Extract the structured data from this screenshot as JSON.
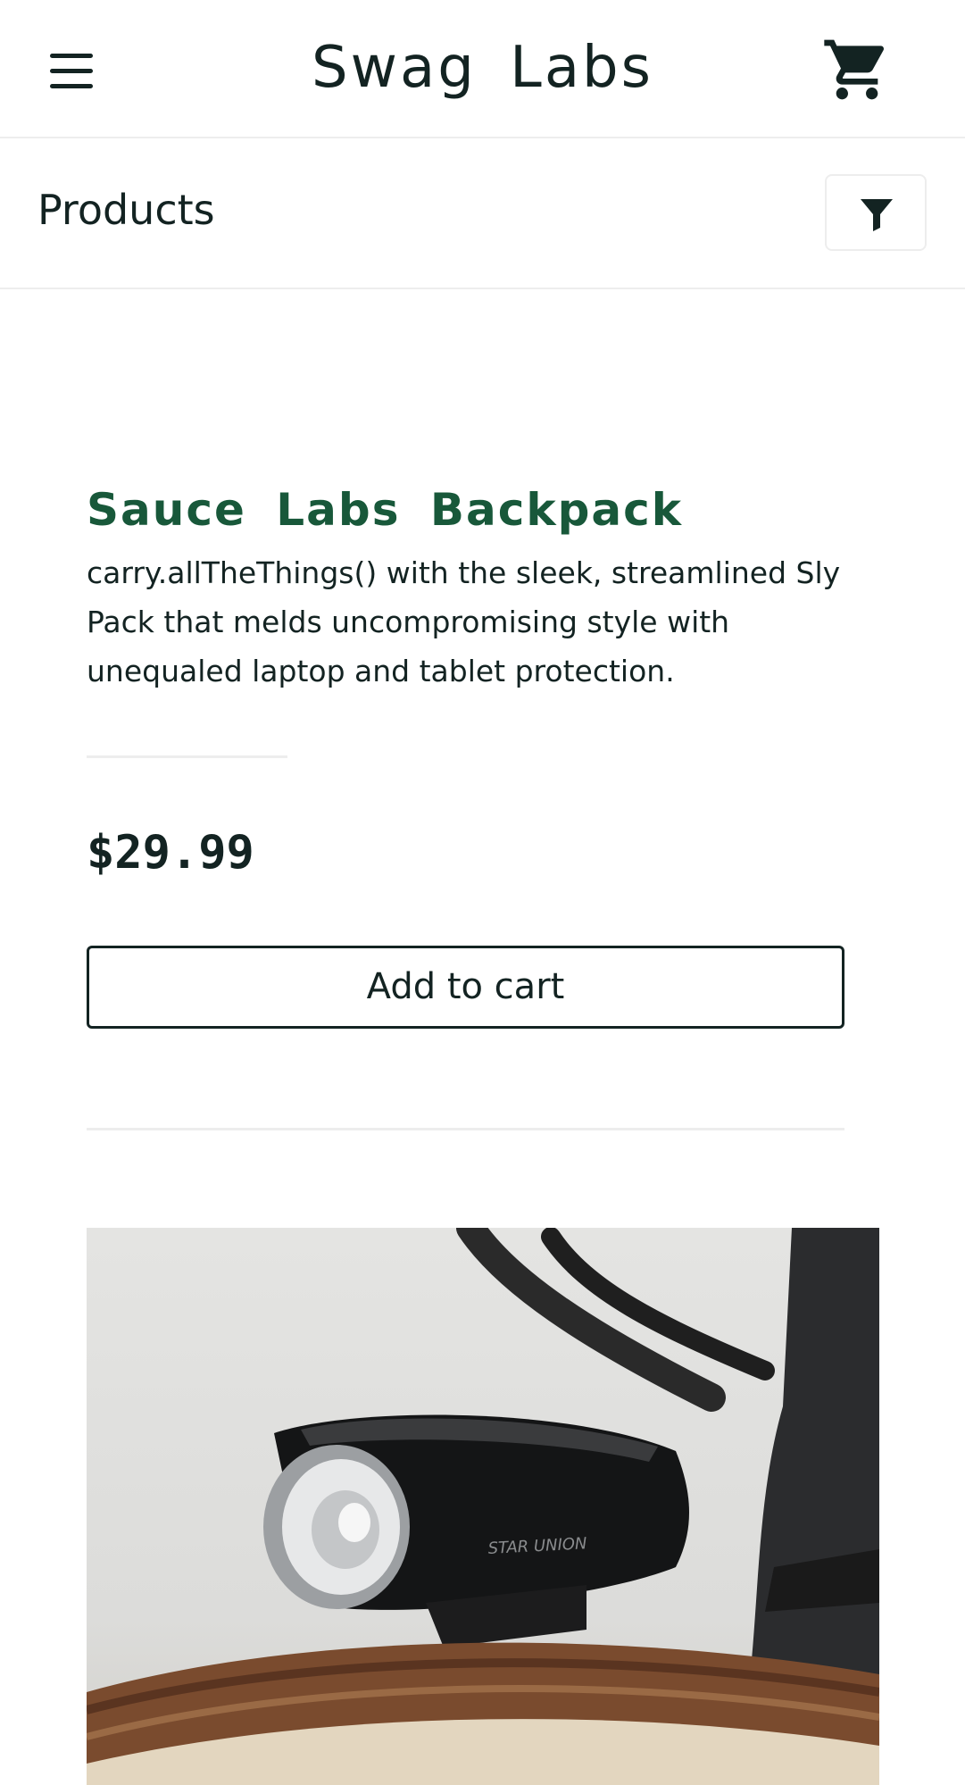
{
  "header": {
    "app_title": "Swag Labs",
    "menu_icon": "hamburger-menu-icon",
    "cart_icon": "shopping-cart-icon"
  },
  "subheader": {
    "title": "Products",
    "filter_icon": "filter-funnel-icon"
  },
  "product": {
    "name": "Sauce Labs Backpack",
    "description": "carry.allTheThings() with the sleek, streamlined Sly Pack that melds uncompromising style with unequaled laptop and tablet protection.",
    "price": "$29.99",
    "add_to_cart_label": "Add to cart"
  },
  "next_product": {
    "image_text": "STAR UNION"
  },
  "colors": {
    "text": "#132322",
    "product_name": "#18583a",
    "divider": "#ededed"
  }
}
